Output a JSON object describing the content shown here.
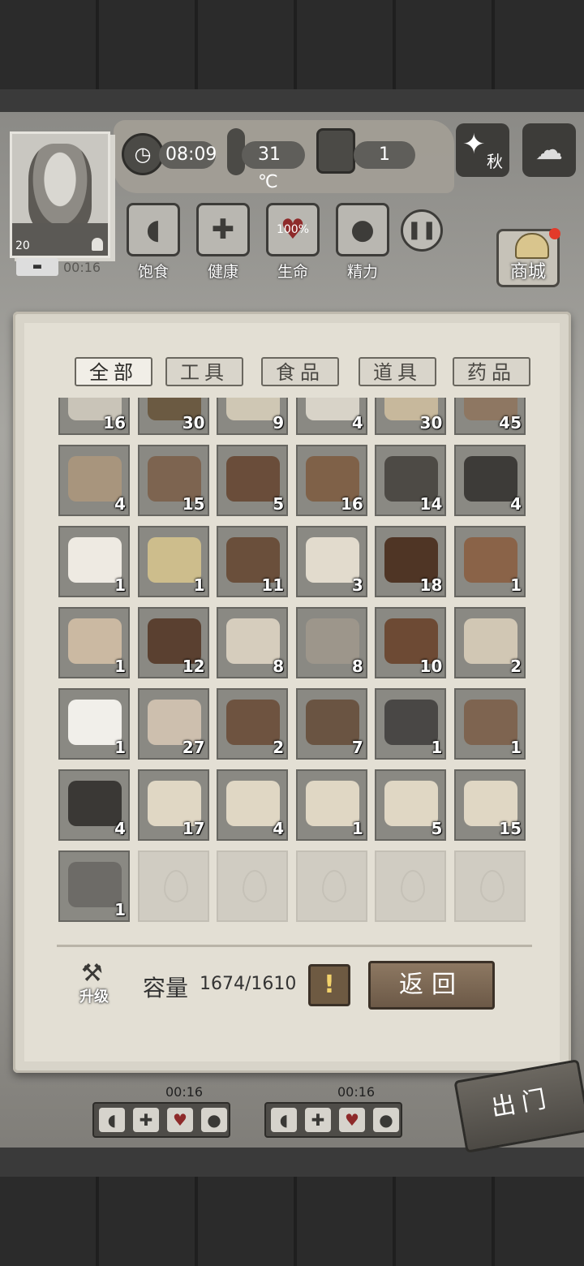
{
  "hud": {
    "clock": "08:09",
    "temperature": "31 ℃",
    "day": "1",
    "season": "秋",
    "level": "20",
    "timer": "00:16",
    "stats": [
      {
        "label": "饱食",
        "icon": "stomach-icon"
      },
      {
        "label": "健康",
        "icon": "cross-icon"
      },
      {
        "label": "生命",
        "icon": "heart-icon",
        "value": "100%"
      },
      {
        "label": "精力",
        "icon": "person-icon"
      }
    ],
    "shop_label": "商城"
  },
  "inventory": {
    "tabs": [
      "全部",
      "工具",
      "食品",
      "道具",
      "药品"
    ],
    "items": [
      {
        "name": "stone-blade",
        "qty": "16",
        "color": "#c9c4b8"
      },
      {
        "name": "leaf",
        "qty": "30",
        "color": "#6b5a42"
      },
      {
        "name": "resin",
        "qty": "9",
        "color": "#cfc7b4"
      },
      {
        "name": "cotton",
        "qty": "4",
        "color": "#d8d3c8"
      },
      {
        "name": "wood-plank",
        "qty": "30",
        "color": "#c7b89c"
      },
      {
        "name": "timber",
        "qty": "45",
        "color": "#8e7762"
      },
      {
        "name": "board",
        "qty": "4",
        "color": "#a8957d"
      },
      {
        "name": "spike",
        "qty": "15",
        "color": "#7d6450"
      },
      {
        "name": "soil",
        "qty": "5",
        "color": "#6a4d3a"
      },
      {
        "name": "bamboo",
        "qty": "16",
        "color": "#7f6148"
      },
      {
        "name": "ore",
        "qty": "14",
        "color": "#4d4a45"
      },
      {
        "name": "iron-ingot",
        "qty": "4",
        "color": "#3d3b38"
      },
      {
        "name": "salt-crystal",
        "qty": "1",
        "color": "#eeeae2"
      },
      {
        "name": "sulfur",
        "qty": "1",
        "color": "#cdbd8c"
      },
      {
        "name": "worm",
        "qty": "11",
        "color": "#6a4f3b"
      },
      {
        "name": "animal-hide",
        "qty": "3",
        "color": "#e2dbcd"
      },
      {
        "name": "mud",
        "qty": "18",
        "color": "#4f3525"
      },
      {
        "name": "clay",
        "qty": "1",
        "color": "#8a6348"
      },
      {
        "name": "meat-slices",
        "qty": "1",
        "color": "#cbb9a2"
      },
      {
        "name": "chopsticks",
        "qty": "12",
        "color": "#5a4030"
      },
      {
        "name": "fangs",
        "qty": "8",
        "color": "#d6cdbd"
      },
      {
        "name": "pearl-shell",
        "qty": "8",
        "color": "#9d968b"
      },
      {
        "name": "dried-meat",
        "qty": "10",
        "color": "#6d4a34"
      },
      {
        "name": "horn",
        "qty": "2",
        "color": "#d1c7b4"
      },
      {
        "name": "flour",
        "qty": "1",
        "color": "#f1efea"
      },
      {
        "name": "mushroom",
        "qty": "27",
        "color": "#cdbfae"
      },
      {
        "name": "backpack",
        "qty": "2",
        "color": "#6e5340"
      },
      {
        "name": "bottle",
        "qty": "7",
        "color": "#6a5442"
      },
      {
        "name": "sword",
        "qty": "1",
        "color": "#494745"
      },
      {
        "name": "necklace",
        "qty": "1",
        "color": "#7e6450"
      },
      {
        "name": "feather-brush",
        "qty": "4",
        "color": "#3a3835"
      },
      {
        "name": "gift-box-food",
        "qty": "17",
        "color": "#e0d7c4"
      },
      {
        "name": "gift-box-medical",
        "qty": "4",
        "color": "#e0d7c4"
      },
      {
        "name": "gift-box-tools",
        "qty": "1",
        "color": "#e0d7c4"
      },
      {
        "name": "gift-box-hammer",
        "qty": "5",
        "color": "#e0d7c4"
      },
      {
        "name": "gift-box-weapon",
        "qty": "15",
        "color": "#e0d7c4"
      },
      {
        "name": "spear",
        "qty": "1",
        "color": "#6d6b67"
      }
    ],
    "empty_slots": 5,
    "upgrade_label": "升级",
    "capacity_label": "容量",
    "capacity_value": "1674/1610",
    "warn_label": "!",
    "back_label": "返回"
  },
  "survivors": [
    {
      "timer": "00:16"
    },
    {
      "timer": "00:16"
    }
  ],
  "exit_label": "出门"
}
